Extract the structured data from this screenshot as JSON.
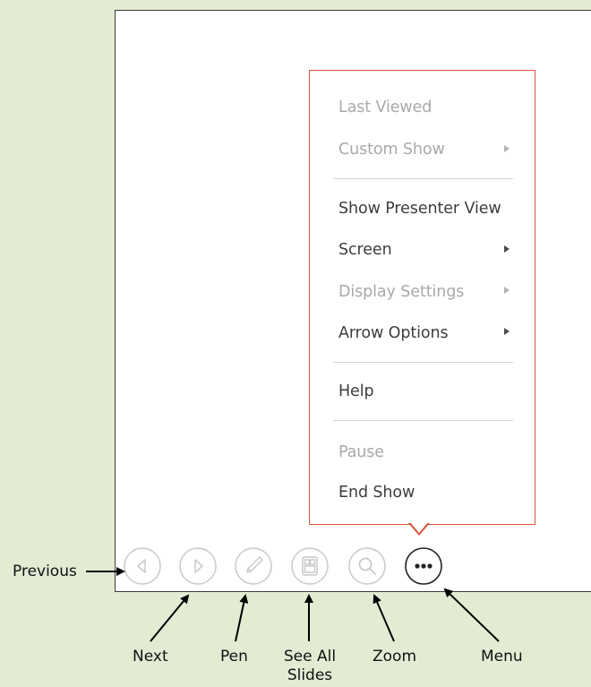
{
  "context_menu": {
    "items": [
      {
        "label": "Last Viewed",
        "enabled": false,
        "submenu": false
      },
      {
        "label": "Custom Show",
        "enabled": false,
        "submenu": true
      },
      {
        "label": "Show Presenter View",
        "enabled": true,
        "submenu": false
      },
      {
        "label": "Screen",
        "enabled": true,
        "submenu": true
      },
      {
        "label": "Display Settings",
        "enabled": false,
        "submenu": true
      },
      {
        "label": "Arrow Options",
        "enabled": true,
        "submenu": true
      },
      {
        "label": "Help",
        "enabled": true,
        "submenu": false
      },
      {
        "label": "Pause",
        "enabled": false,
        "submenu": false
      },
      {
        "label": "End Show",
        "enabled": true,
        "submenu": false
      }
    ]
  },
  "toolbar": {
    "buttons": [
      {
        "icon": "previous-icon",
        "state": "faded"
      },
      {
        "icon": "next-icon",
        "state": "faded"
      },
      {
        "icon": "pen-icon",
        "state": "faded"
      },
      {
        "icon": "see-all-slides-icon",
        "state": "faded"
      },
      {
        "icon": "zoom-icon",
        "state": "faded"
      },
      {
        "icon": "more-menu-icon",
        "state": "active"
      }
    ]
  },
  "callouts": {
    "previous": "Previous",
    "next": "Next",
    "pen": "Pen",
    "see_all_slides_line1": "See All",
    "see_all_slides_line2": "Slides",
    "zoom": "Zoom",
    "menu": "Menu"
  },
  "colors": {
    "background": "#e3ecd3",
    "menu_border": "#d8553c",
    "control_faded": "#c9c9c9",
    "control_active": "#222222"
  }
}
